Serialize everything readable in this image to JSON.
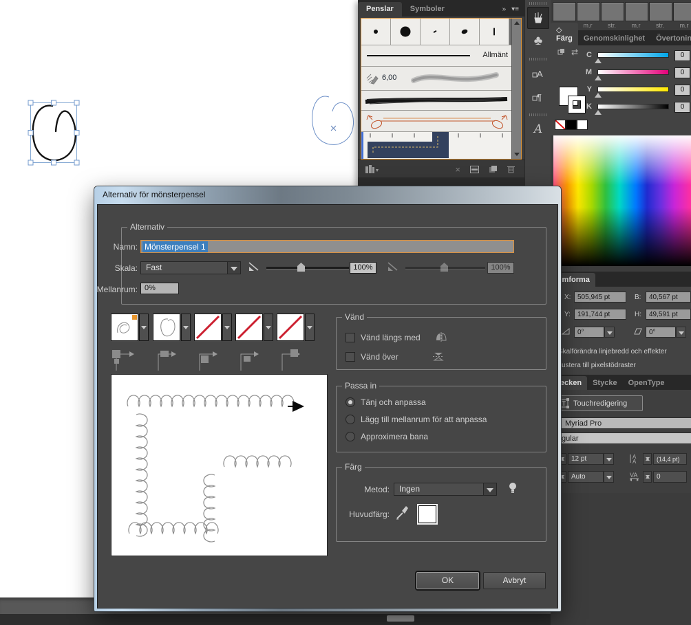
{
  "colors": {
    "focus_orange": "#dd9336",
    "selection_blue": "#3c7fbe",
    "cmyk": [
      "#00a5e8",
      "#e5007a",
      "#ffe800",
      "#000000"
    ]
  },
  "brushes_panel": {
    "tabs": [
      {
        "label": "Penslar"
      },
      {
        "label": "Symboler"
      }
    ],
    "general_brush_label": "Allmänt",
    "bristle_brush_size": "6,00"
  },
  "styles_strip": {
    "labels": [
      "str.",
      "m.r",
      "str.",
      "m.r",
      "str.",
      "m.r"
    ]
  },
  "color_panel": {
    "tabs": [
      "Färg",
      "Genomskinlighet",
      "Övertoning"
    ],
    "sliders": [
      {
        "label": "C",
        "value": "0"
      },
      {
        "label": "M",
        "value": "0"
      },
      {
        "label": "Y",
        "value": "0"
      },
      {
        "label": "K",
        "value": "0"
      }
    ]
  },
  "transform_panel": {
    "tab": "Omforma",
    "x_label": "X:",
    "x_value": "505,945 pt",
    "y_label": "Y:",
    "y_value": "191,744 pt",
    "w_label": "B:",
    "w_value": "40,567 pt",
    "h_label": "H:",
    "h_value": "49,591 pt",
    "rotate_value": "0°",
    "shear_value": "0°",
    "checkboxes": [
      "Skalförändra linjebredd och effekter",
      "Justera till pixelstödraster"
    ]
  },
  "character_panel": {
    "tabs": [
      "Tecken",
      "Stycke",
      "OpenType"
    ],
    "touch_button": "Touchredigering",
    "font_name": "Myriad Pro",
    "font_style": "Regular",
    "size_value": "12 pt",
    "leading_value": "(14,4 pt)",
    "kerning_value": "Auto",
    "tracking_value": "0"
  },
  "dialog": {
    "title": "Alternativ för mönsterpensel",
    "options_group": {
      "legend": "Alternativ",
      "name_label": "Namn:",
      "name_value": "Mönsterpensel 1",
      "scale_label": "Skala:",
      "scale_value": "Fast",
      "slider1_value": "100%",
      "slider2_value": "100%",
      "spacing_label": "Mellanrum:",
      "spacing_value": "0%"
    },
    "flip_group": {
      "legend": "Vänd",
      "flip_along": "Vänd längs med",
      "flip_across": "Vänd över"
    },
    "fit_group": {
      "legend": "Passa in",
      "options": [
        "Tänj och anpassa",
        "Lägg till mellanrum för att anpassa",
        "Approximera bana"
      ],
      "selected_index": 0
    },
    "color_group": {
      "legend": "Färg",
      "method_label": "Metod:",
      "method_value": "Ingen",
      "key_color_label": "Huvudfärg:"
    },
    "ok_label": "OK",
    "cancel_label": "Avbryt"
  }
}
